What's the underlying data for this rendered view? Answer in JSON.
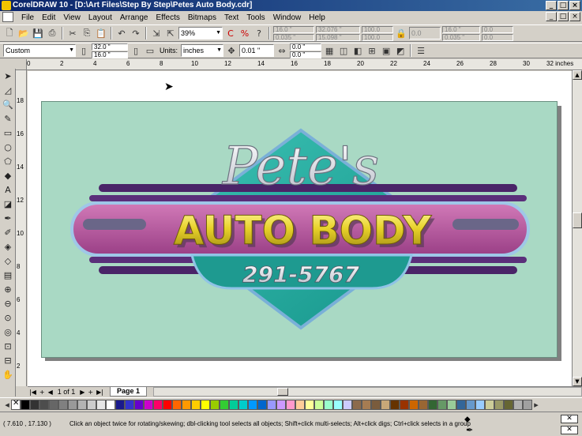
{
  "window": {
    "title": "CorelDRAW 10 - [D:\\Art Files\\Step By Step\\Petes Auto Body.cdr]",
    "minimize": "_",
    "maximize": "□",
    "close": "×"
  },
  "menu": [
    "File",
    "Edit",
    "View",
    "Layout",
    "Arrange",
    "Effects",
    "Bitmaps",
    "Text",
    "Tools",
    "Window",
    "Help"
  ],
  "standard_toolbar": {
    "zoom_level": "39%",
    "pos_x": "16.0 \"",
    "pos_y": "0.035 \"",
    "size_w": "32.076 \"",
    "size_h": "15.098 \"",
    "scale_x": "100.0",
    "scale_y": "100.0",
    "angle": "0.0",
    "dup_x": "16.0 \"",
    "dup_y": "0.035 \"",
    "dup_w": "0.0",
    "dup_h": "0.0"
  },
  "property_bar": {
    "paper_type": "Custom",
    "width": "32.0 \"",
    "height": "16.0 \"",
    "units_label": "Units:",
    "units_value": "inches",
    "nudge": "0.01 \"",
    "dup_distance_x": "0.0 \"",
    "dup_distance_y": "0.0 \""
  },
  "ruler": {
    "h_labels": [
      "0",
      "2",
      "4",
      "6",
      "8",
      "10",
      "12",
      "14",
      "16",
      "18",
      "20",
      "22",
      "24",
      "26",
      "28",
      "30",
      "32 inches"
    ],
    "v_labels": [
      "18",
      "16",
      "14",
      "12",
      "10",
      "8",
      "6",
      "4",
      "2"
    ]
  },
  "logo": {
    "script": "Pete's",
    "headline": "AUTO BODY",
    "phone": "291-5767"
  },
  "page_nav": {
    "counter": "1 of 1",
    "tab": "Page 1"
  },
  "palette": {
    "colors": [
      "#000000",
      "#333333",
      "#4d4d4d",
      "#666666",
      "#808080",
      "#999999",
      "#b3b3b3",
      "#cccccc",
      "#e6e6e6",
      "#ffffff",
      "#1a1a8c",
      "#3333cc",
      "#6600cc",
      "#cc00cc",
      "#ff0066",
      "#ff0000",
      "#ff6600",
      "#ff9900",
      "#ffcc00",
      "#ffff00",
      "#99cc00",
      "#33cc33",
      "#00cc99",
      "#00cccc",
      "#0099ff",
      "#0066cc",
      "#9999ff",
      "#cc99ff",
      "#ff99cc",
      "#ffcc99",
      "#ffff99",
      "#ccff99",
      "#99ffcc",
      "#99ffff",
      "#ccccff",
      "#8c6b4d",
      "#a67c52",
      "#7a5c3d",
      "#c8a878",
      "#663300",
      "#993300",
      "#cc6600",
      "#996633",
      "#336633",
      "#669966",
      "#99cc99",
      "#336699",
      "#6699cc",
      "#99ccff",
      "#cccc99",
      "#999966",
      "#666633",
      "#b0b0b0",
      "#a0a0a0"
    ]
  },
  "status": {
    "coords": "( 7.610 , 17.130 )",
    "hint": "Click an object twice for rotating/skewing; dbl-clicking tool selects all objects; Shift+click multi-selects; Alt+click digs; Ctrl+click selects in a group"
  }
}
